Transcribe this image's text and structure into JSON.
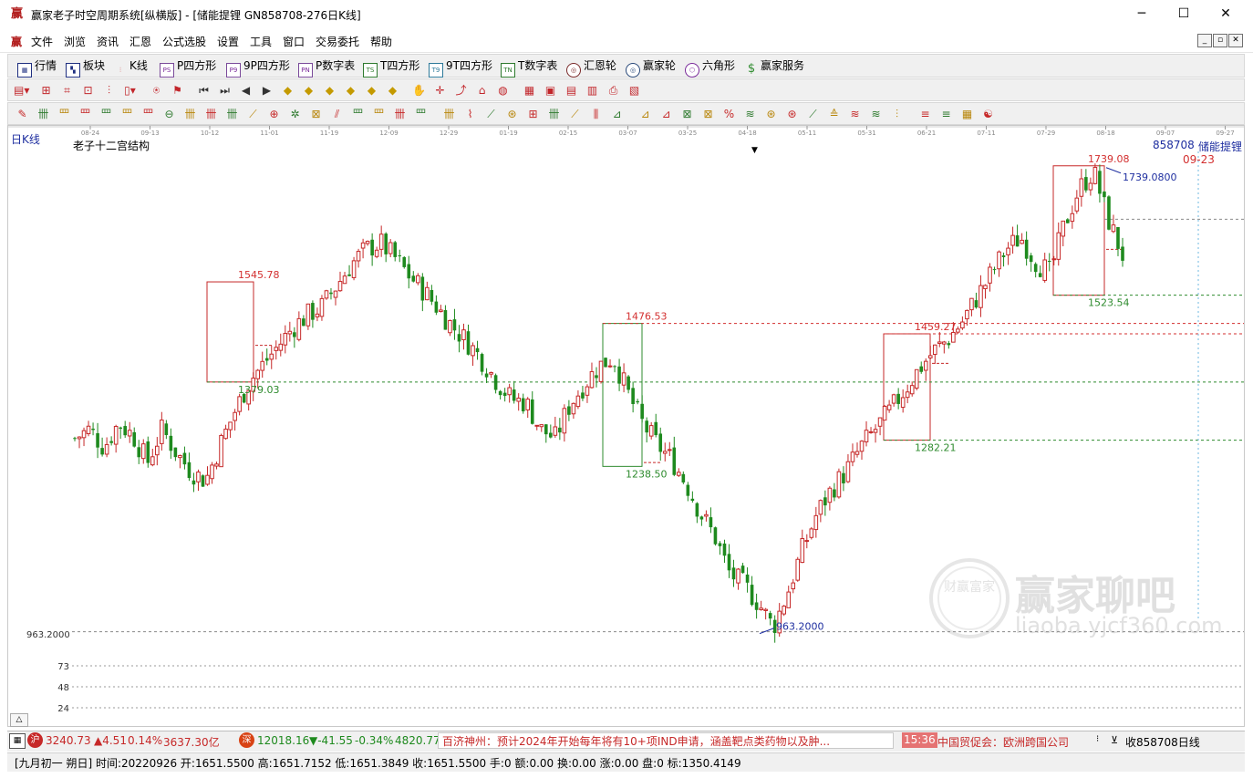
{
  "window": {
    "title": "赢家老子时空周期系统[纵横版] - [储能提锂  GN858708-276日K线]",
    "app_icon": "赢",
    "min": "─",
    "max": "☐",
    "close": "✕"
  },
  "menu": [
    "文件",
    "浏览",
    "资讯",
    "汇恩",
    "公式选股",
    "设置",
    "工具",
    "窗口",
    "交易委托",
    "帮助"
  ],
  "mdi_buttons": [
    "_",
    "▫",
    "✕"
  ],
  "toolbar1": [
    {
      "icon": "grid-icon",
      "label": "行情"
    },
    {
      "icon": "blocks-icon",
      "label": "板块"
    },
    {
      "icon": "kline-icon",
      "label": "K线"
    },
    {
      "icon": "PS",
      "label": "P四方形"
    },
    {
      "icon": "P9",
      "label": "9P四方形"
    },
    {
      "icon": "PN",
      "label": "P数字表"
    },
    {
      "icon": "TS",
      "label": "T四方形"
    },
    {
      "icon": "T9",
      "label": "9T四方形"
    },
    {
      "icon": "TN",
      "label": "T数字表"
    },
    {
      "icon": "wheel-icon",
      "label": "汇恩轮"
    },
    {
      "icon": "wheel-icon",
      "label": "赢家轮"
    },
    {
      "icon": "hexagon-icon",
      "label": "六角形"
    },
    {
      "icon": "dollar-icon",
      "label": "赢家服务"
    }
  ],
  "toolbar2_icons": [
    "period-dropdown-icon",
    "zoom-fit-icon",
    "indicator-icon",
    "indicator2-icon",
    "bar-chart-icon",
    "number-dropdown-icon",
    "cycle-icon",
    "flag-icon",
    "first-icon",
    "last-icon",
    "prev-icon",
    "next-icon",
    "diamond1-icon",
    "diamond2-icon",
    "diamond3-icon",
    "diamond4-icon",
    "diamond5-icon",
    "diamond6-icon",
    "hand-icon",
    "crosshair-icon",
    "trend-icon",
    "tag-icon",
    "globe-icon",
    "calendar-icon",
    "calc-icon",
    "doc-icon",
    "save-icon",
    "print-icon",
    "export-icon"
  ],
  "toolbar3_icons": [
    "pen-icon",
    "line1-icon",
    "line2-icon",
    "line3-icon",
    "line4-icon",
    "line5-icon",
    "line6-icon",
    "circle-icon",
    "grid1-icon",
    "grid2-icon",
    "grid3-icon",
    "fan-icon",
    "target-icon",
    "star-icon",
    "net-icon",
    "par-icon",
    "gann1-icon",
    "gann2-icon",
    "gann3-icon",
    "gann4-icon",
    "mark1-icon",
    "mark2-icon",
    "mark3-icon",
    "mark4-icon",
    "mark5-icon",
    "mark6-icon",
    "mark7-icon",
    "mark8-icon",
    "mark9-icon",
    "mark10-icon",
    "mark11-icon",
    "mark12-icon",
    "percent-icon",
    "mark13-icon",
    "mark14-icon",
    "mark15-icon",
    "mark16-icon",
    "mark17-icon",
    "mark18-icon",
    "mark19-icon",
    "mark20-icon",
    "mark21-icon",
    "mark22-icon",
    "table-icon",
    "yinyang-icon",
    "infinity-icon"
  ],
  "chart_header": {
    "period_label": "日K线",
    "study_label": "老子十二宫结构",
    "code": "858708",
    "name": "储能提锂",
    "date_marker": "09-23",
    "low_axis_label": "963.2000"
  },
  "chart_data": {
    "type": "candlestick",
    "x_ticks": [
      "08-24",
      "09-13",
      "10-12",
      "11-01",
      "11-19",
      "12-09",
      "12-29",
      "01-19",
      "02-15",
      "03-07",
      "03-25",
      "04-18",
      "05-11",
      "05-31",
      "06-21",
      "07-11",
      "07-29",
      "08-18",
      "09-07",
      "09-27"
    ],
    "volume_ticks": [
      "73",
      "48",
      "24"
    ],
    "annotations": [
      {
        "label": "1545.78",
        "color": "#d32f2f"
      },
      {
        "label": "1379.03",
        "color": "#2e8b2e"
      },
      {
        "label": "1476.53",
        "color": "#d32f2f"
      },
      {
        "label": "1238.50",
        "color": "#2e8b2e"
      },
      {
        "label": "1459.27",
        "color": "#d32f2f"
      },
      {
        "label": "1282.21",
        "color": "#2e8b2e"
      },
      {
        "label": "1739.08",
        "color": "#d32f2f"
      },
      {
        "label": "1739.0800",
        "color": "#1f2fa0"
      },
      {
        "label": "1523.54",
        "color": "#2e8b2e"
      },
      {
        "label": "963.2000",
        "color": "#1f2fa0"
      }
    ],
    "colors": {
      "up": "#c62828",
      "down": "#1e8a1e",
      "resistance": "#d32f2f",
      "support": "#2e8b2e",
      "accent": "#1f2fa0"
    },
    "close_path": [
      1285,
      1300,
      1270,
      1310,
      1290,
      1245,
      1300,
      1260,
      1230,
      1215,
      1275,
      1330,
      1380,
      1410,
      1440,
      1470,
      1490,
      1505,
      1540,
      1575,
      1600,
      1610,
      1585,
      1555,
      1530,
      1500,
      1470,
      1445,
      1415,
      1380,
      1350,
      1345,
      1300,
      1285,
      1340,
      1375,
      1405,
      1420,
      1360,
      1310,
      1275,
      1250,
      1210,
      1160,
      1120,
      1060,
      1040,
      1010,
      970,
      1030,
      1100,
      1160,
      1200,
      1230,
      1270,
      1300,
      1330,
      1365,
      1400,
      1430,
      1450,
      1480,
      1520,
      1560,
      1600,
      1620,
      1580,
      1560,
      1640,
      1700,
      1730,
      1650,
      1590
    ],
    "watermark": {
      "title": "赢家聊吧",
      "url": "liaoba.yjcf360.com",
      "seal": "财赢富家"
    }
  },
  "status1": {
    "sh_icon": "沪",
    "sh_index": "3240.73",
    "sh_change": "▲4.51",
    "sh_pct": "0.14%",
    "sh_amount": "3637.30亿",
    "sz_icon": "深",
    "sz_index": "12018.16",
    "sz_change": "▼-41.55",
    "sz_pct": "-0.34%",
    "sz_amount": "4820.77",
    "news": "百济神州：预计2024年开始每年将有10+项IND申请，涵盖靶点类药物以及肿...",
    "news_time": "15:36",
    "news2": "中国贸促会：欧洲跨国公司",
    "right_label": "收858708日线"
  },
  "status2": {
    "text": "[九月初一  朔日] 时间:20220926 开:1651.5500 高:1651.7152 低:1651.3849 收:1651.5500 手:0 额:0.00 换:0.00 涨:0.00 盘:0 标:1350.4149"
  }
}
